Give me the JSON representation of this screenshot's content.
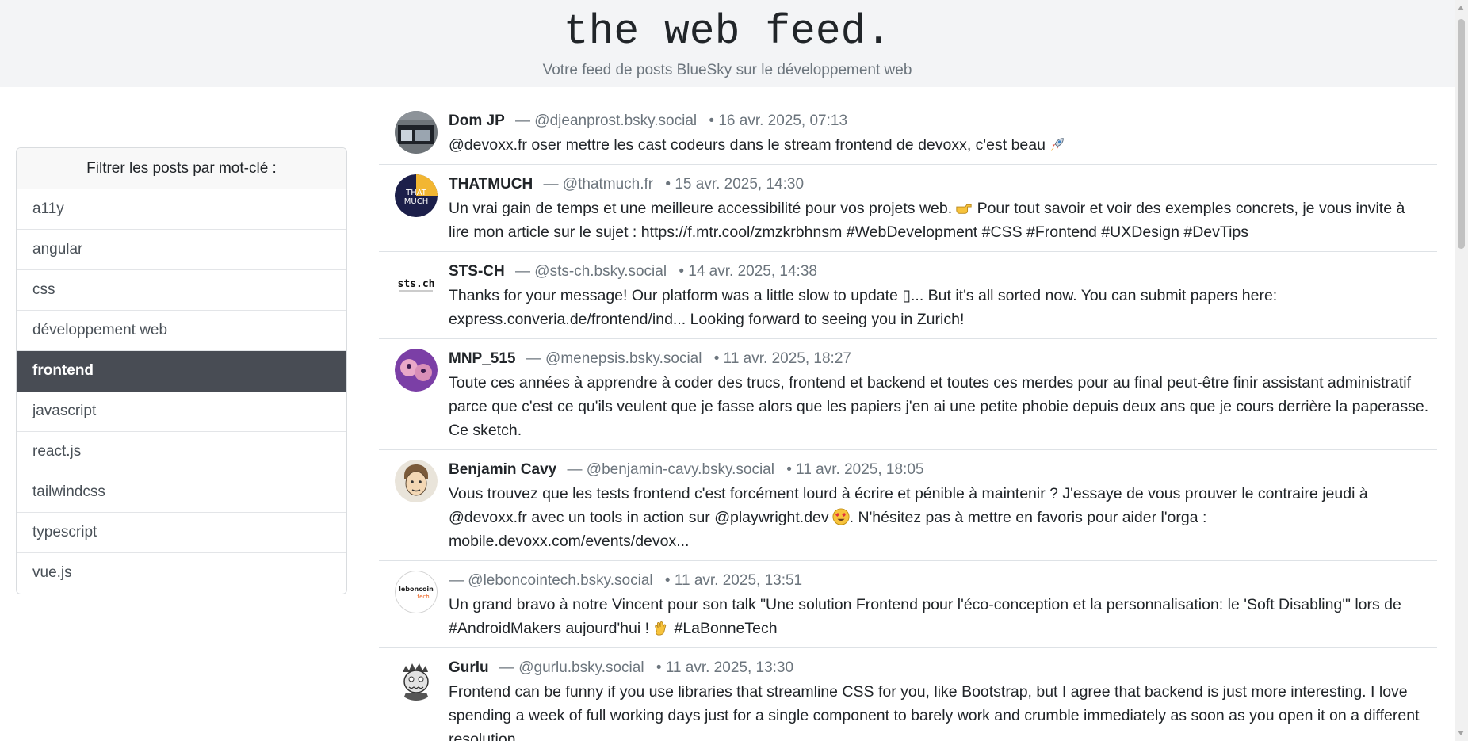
{
  "header": {
    "title": "the web feed.",
    "subtitle": "Votre feed de posts BlueSky sur le développement web"
  },
  "sidebar": {
    "heading": "Filtrer les posts par mot-clé :",
    "active_keyword": "frontend",
    "keywords": [
      "a11y",
      "angular",
      "css",
      "développement web",
      "frontend",
      "javascript",
      "react.js",
      "tailwindcss",
      "typescript",
      "vue.js"
    ]
  },
  "posts": [
    {
      "author": "Dom JP",
      "handle": "— @djeanprost.bsky.social",
      "date": "• 16 avr. 2025, 07:13",
      "text": "@devoxx.fr oser mettre les cast codeurs dans le stream frontend de devoxx, c'est beau",
      "emoji": "rocket-icon"
    },
    {
      "author": "THATMUCH",
      "handle": "— @thatmuch.fr",
      "date": "• 15 avr. 2025, 14:30",
      "avatar_text": "THAT MUCH",
      "text_before": "Un vrai gain de temps et une meilleure accessibilité pour vos projets web.",
      "emoji": "pointing-hand-icon",
      "text_after": "Pour tout savoir et voir des exemples concrets, je vous invite à lire mon article sur le sujet : https://f.mtr.cool/zmzkrbhnsm  #WebDevelopment #CSS #Frontend #UXDesign #DevTips"
    },
    {
      "author": "STS-CH",
      "handle": "— @sts-ch.bsky.social",
      "date": "• 14 avr. 2025, 14:38",
      "avatar_text": "sts.ch",
      "text": "Thanks for your message! Our platform was a little slow to update ▯... But it's all sorted now. You can submit papers here: express.converia.de/frontend/ind... Looking forward to seeing you in Zurich!"
    },
    {
      "author": "MNP_515",
      "handle": "— @menepsis.bsky.social",
      "date": "• 11 avr. 2025, 18:27",
      "text": "Toute ces années à apprendre à coder des trucs, frontend et backend et toutes ces merdes pour au final peut-être finir assistant administratif parce que c'est ce qu'ils veulent que je fasse alors que les papiers j'en ai une petite phobie depuis deux ans que je cours derrière la paperasse. Ce sketch."
    },
    {
      "author": "Benjamin Cavy",
      "handle": "— @benjamin-cavy.bsky.social",
      "date": "• 11 avr. 2025, 18:05",
      "text_before": "Vous trouvez que les tests frontend c'est forcément lourd à écrire et pénible à maintenir ? J'essaye de vous prouver le contraire jeudi à @devoxx.fr avec un tools in action sur @playwright.dev",
      "emoji": "heart-eyes-icon",
      "text_after": ". N'hésitez pas à mettre en favoris pour aider l'orga : mobile.devoxx.com/events/devox..."
    },
    {
      "author": "",
      "handle": "— @leboncointech.bsky.social",
      "date": "• 11 avr. 2025, 13:51",
      "avatar_text": "leboncoin",
      "avatar_subtext": "tech",
      "text_before": "Un grand bravo à notre Vincent pour son talk \"Une solution Frontend pour l'éco-conception et la personnalisation: le 'Soft Disabling'\" lors de #AndroidMakers aujourd'hui !",
      "emoji": "clapping-hands-icon",
      "text_after": "#LaBonneTech"
    },
    {
      "author": "Gurlu",
      "handle": "— @gurlu.bsky.social",
      "date": "• 11 avr. 2025, 13:30",
      "text": "Frontend can be funny if you use libraries that streamline CSS for you, like Bootstrap, but I agree that backend is just more interesting. I love spending a week of full working days just for a single component to barely work and crumble immediately as soon as you open it on a different resolution."
    }
  ],
  "colors": {
    "header_bg": "#f3f4f6",
    "active_bg": "#484c54",
    "muted_text": "#6c757d",
    "border": "#dee2e6"
  }
}
